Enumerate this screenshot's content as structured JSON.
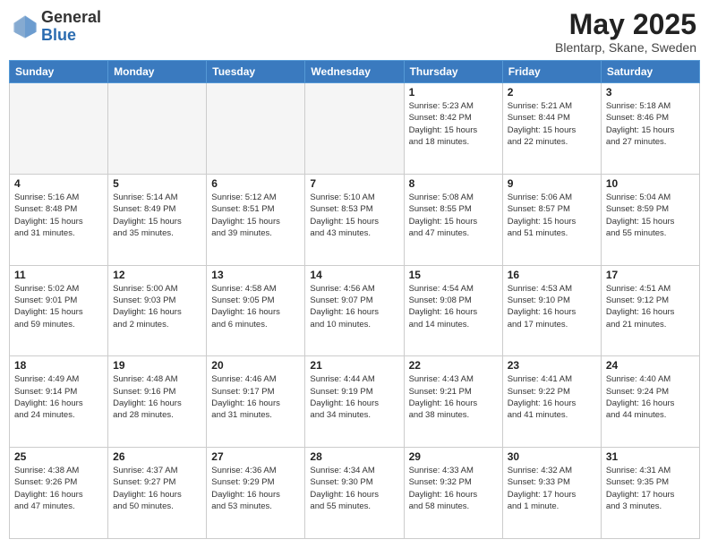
{
  "header": {
    "logo_general": "General",
    "logo_blue": "Blue",
    "month_title": "May 2025",
    "location": "Blentarp, Skane, Sweden"
  },
  "weekdays": [
    "Sunday",
    "Monday",
    "Tuesday",
    "Wednesday",
    "Thursday",
    "Friday",
    "Saturday"
  ],
  "weeks": [
    [
      {
        "day": "",
        "info": ""
      },
      {
        "day": "",
        "info": ""
      },
      {
        "day": "",
        "info": ""
      },
      {
        "day": "",
        "info": ""
      },
      {
        "day": "1",
        "info": "Sunrise: 5:23 AM\nSunset: 8:42 PM\nDaylight: 15 hours\nand 18 minutes."
      },
      {
        "day": "2",
        "info": "Sunrise: 5:21 AM\nSunset: 8:44 PM\nDaylight: 15 hours\nand 22 minutes."
      },
      {
        "day": "3",
        "info": "Sunrise: 5:18 AM\nSunset: 8:46 PM\nDaylight: 15 hours\nand 27 minutes."
      }
    ],
    [
      {
        "day": "4",
        "info": "Sunrise: 5:16 AM\nSunset: 8:48 PM\nDaylight: 15 hours\nand 31 minutes."
      },
      {
        "day": "5",
        "info": "Sunrise: 5:14 AM\nSunset: 8:49 PM\nDaylight: 15 hours\nand 35 minutes."
      },
      {
        "day": "6",
        "info": "Sunrise: 5:12 AM\nSunset: 8:51 PM\nDaylight: 15 hours\nand 39 minutes."
      },
      {
        "day": "7",
        "info": "Sunrise: 5:10 AM\nSunset: 8:53 PM\nDaylight: 15 hours\nand 43 minutes."
      },
      {
        "day": "8",
        "info": "Sunrise: 5:08 AM\nSunset: 8:55 PM\nDaylight: 15 hours\nand 47 minutes."
      },
      {
        "day": "9",
        "info": "Sunrise: 5:06 AM\nSunset: 8:57 PM\nDaylight: 15 hours\nand 51 minutes."
      },
      {
        "day": "10",
        "info": "Sunrise: 5:04 AM\nSunset: 8:59 PM\nDaylight: 15 hours\nand 55 minutes."
      }
    ],
    [
      {
        "day": "11",
        "info": "Sunrise: 5:02 AM\nSunset: 9:01 PM\nDaylight: 15 hours\nand 59 minutes."
      },
      {
        "day": "12",
        "info": "Sunrise: 5:00 AM\nSunset: 9:03 PM\nDaylight: 16 hours\nand 2 minutes."
      },
      {
        "day": "13",
        "info": "Sunrise: 4:58 AM\nSunset: 9:05 PM\nDaylight: 16 hours\nand 6 minutes."
      },
      {
        "day": "14",
        "info": "Sunrise: 4:56 AM\nSunset: 9:07 PM\nDaylight: 16 hours\nand 10 minutes."
      },
      {
        "day": "15",
        "info": "Sunrise: 4:54 AM\nSunset: 9:08 PM\nDaylight: 16 hours\nand 14 minutes."
      },
      {
        "day": "16",
        "info": "Sunrise: 4:53 AM\nSunset: 9:10 PM\nDaylight: 16 hours\nand 17 minutes."
      },
      {
        "day": "17",
        "info": "Sunrise: 4:51 AM\nSunset: 9:12 PM\nDaylight: 16 hours\nand 21 minutes."
      }
    ],
    [
      {
        "day": "18",
        "info": "Sunrise: 4:49 AM\nSunset: 9:14 PM\nDaylight: 16 hours\nand 24 minutes."
      },
      {
        "day": "19",
        "info": "Sunrise: 4:48 AM\nSunset: 9:16 PM\nDaylight: 16 hours\nand 28 minutes."
      },
      {
        "day": "20",
        "info": "Sunrise: 4:46 AM\nSunset: 9:17 PM\nDaylight: 16 hours\nand 31 minutes."
      },
      {
        "day": "21",
        "info": "Sunrise: 4:44 AM\nSunset: 9:19 PM\nDaylight: 16 hours\nand 34 minutes."
      },
      {
        "day": "22",
        "info": "Sunrise: 4:43 AM\nSunset: 9:21 PM\nDaylight: 16 hours\nand 38 minutes."
      },
      {
        "day": "23",
        "info": "Sunrise: 4:41 AM\nSunset: 9:22 PM\nDaylight: 16 hours\nand 41 minutes."
      },
      {
        "day": "24",
        "info": "Sunrise: 4:40 AM\nSunset: 9:24 PM\nDaylight: 16 hours\nand 44 minutes."
      }
    ],
    [
      {
        "day": "25",
        "info": "Sunrise: 4:38 AM\nSunset: 9:26 PM\nDaylight: 16 hours\nand 47 minutes."
      },
      {
        "day": "26",
        "info": "Sunrise: 4:37 AM\nSunset: 9:27 PM\nDaylight: 16 hours\nand 50 minutes."
      },
      {
        "day": "27",
        "info": "Sunrise: 4:36 AM\nSunset: 9:29 PM\nDaylight: 16 hours\nand 53 minutes."
      },
      {
        "day": "28",
        "info": "Sunrise: 4:34 AM\nSunset: 9:30 PM\nDaylight: 16 hours\nand 55 minutes."
      },
      {
        "day": "29",
        "info": "Sunrise: 4:33 AM\nSunset: 9:32 PM\nDaylight: 16 hours\nand 58 minutes."
      },
      {
        "day": "30",
        "info": "Sunrise: 4:32 AM\nSunset: 9:33 PM\nDaylight: 17 hours\nand 1 minute."
      },
      {
        "day": "31",
        "info": "Sunrise: 4:31 AM\nSunset: 9:35 PM\nDaylight: 17 hours\nand 3 minutes."
      }
    ]
  ]
}
